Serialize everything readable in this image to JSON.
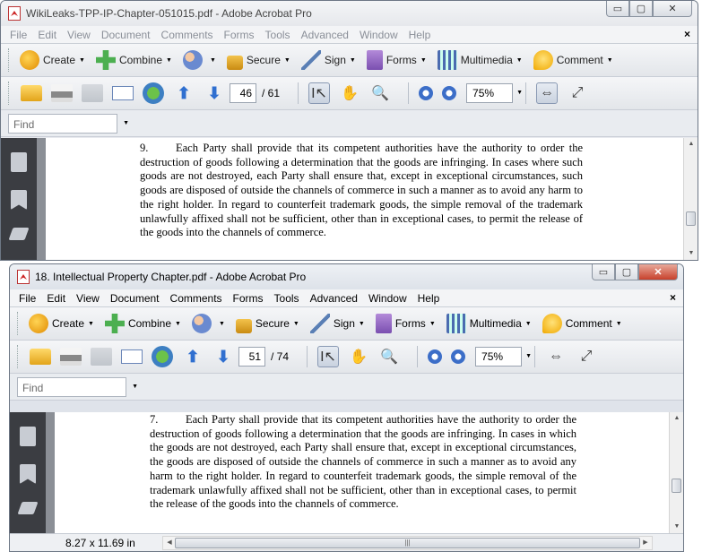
{
  "back_window": {
    "title": "WikiLeaks-TPP-IP-Chapter-051015.pdf - Adobe Acrobat Pro",
    "caption": {
      "minimize": "▭",
      "maximize": "▢",
      "close": "✕"
    },
    "menu": [
      "File",
      "Edit",
      "View",
      "Document",
      "Comments",
      "Forms",
      "Tools",
      "Advanced",
      "Window",
      "Help"
    ],
    "menu_close": "×",
    "tasks": [
      {
        "label": "Create",
        "icon": "create-icon"
      },
      {
        "label": "Combine",
        "icon": "combine-icon"
      },
      {
        "label": "",
        "icon": "collaborate-icon"
      },
      {
        "label": "Secure",
        "icon": "lock-icon"
      },
      {
        "label": "Sign",
        "icon": "pen-icon"
      },
      {
        "label": "Forms",
        "icon": "forms-icon"
      },
      {
        "label": "Multimedia",
        "icon": "multimedia-icon"
      },
      {
        "label": "Comment",
        "icon": "comment-icon"
      }
    ],
    "page_current": "46",
    "page_total": "/ 61",
    "zoom": "75%",
    "find_placeholder": "Find",
    "paragraph_number": "9.",
    "paragraph": "Each Party shall provide that its competent authorities have the authority to order the destruction of goods following a determination that the goods are infringing. In cases where such goods are not destroyed, each Party shall ensure that, except in exceptional circumstances, such goods are disposed of outside the channels of commerce in such a manner as to avoid any harm to the right holder. In regard to counterfeit trademark goods, the simple removal of the trademark unlawfully affixed shall not be sufficient, other than in exceptional cases, to permit the release of the goods into the channels of commerce."
  },
  "front_window": {
    "title": "18. Intellectual Property Chapter.pdf - Adobe Acrobat Pro",
    "caption": {
      "minimize": "▭",
      "maximize": "▢",
      "close": "✕"
    },
    "menu": [
      "File",
      "Edit",
      "View",
      "Document",
      "Comments",
      "Forms",
      "Tools",
      "Advanced",
      "Window",
      "Help"
    ],
    "menu_close": "×",
    "tasks": [
      {
        "label": "Create",
        "icon": "create-icon"
      },
      {
        "label": "Combine",
        "icon": "combine-icon"
      },
      {
        "label": "",
        "icon": "collaborate-icon"
      },
      {
        "label": "Secure",
        "icon": "lock-icon"
      },
      {
        "label": "Sign",
        "icon": "pen-icon"
      },
      {
        "label": "Forms",
        "icon": "forms-icon"
      },
      {
        "label": "Multimedia",
        "icon": "multimedia-icon"
      },
      {
        "label": "Comment",
        "icon": "comment-icon"
      }
    ],
    "page_current": "51",
    "page_total": "/ 74",
    "zoom": "75%",
    "find_placeholder": "Find",
    "paragraph_number": "7.",
    "paragraph": "Each Party shall provide that its competent authorities have the authority to order the destruction of goods following a determination that the goods are infringing. In cases in which the goods are not destroyed, each Party shall ensure that, except in exceptional circumstances, the goods are disposed of outside the channels of commerce in such a manner as to avoid any harm to the right holder.  In regard to counterfeit trademark goods, the simple removal of the trademark unlawfully affixed shall not be sufficient, other than in exceptional cases, to permit the release of the goods into the channels of commerce.",
    "page_size": "8.27 x 11.69 in"
  }
}
